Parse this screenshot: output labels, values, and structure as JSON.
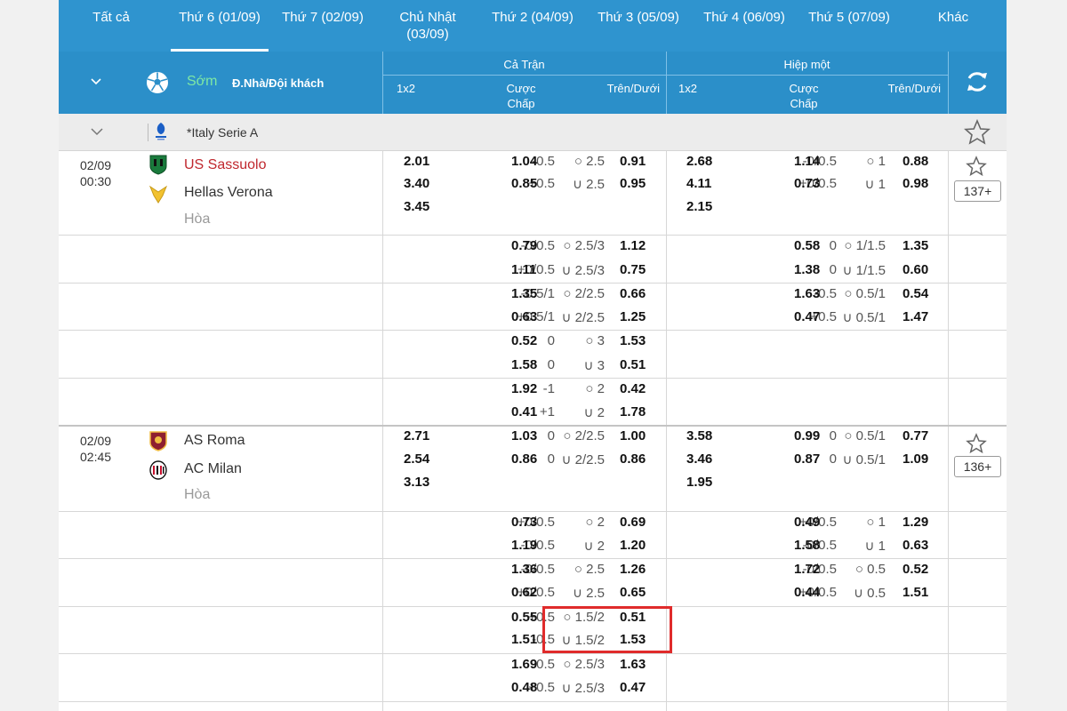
{
  "tabs": [
    {
      "label": "Tất cả"
    },
    {
      "label": "Thứ 6 (01/09)",
      "active": true
    },
    {
      "label": "Thứ 7 (02/09)"
    },
    {
      "label": "Chủ Nhật (03/09)"
    },
    {
      "label": "Thứ 2 (04/09)"
    },
    {
      "label": "Thứ 3 (05/09)"
    },
    {
      "label": "Thứ 4 (06/09)"
    },
    {
      "label": "Thứ 5 (07/09)"
    },
    {
      "label": "Khác"
    }
  ],
  "header": {
    "soon": "Sớm",
    "home_away": "Đ.Nhà/Đội khách",
    "full_match": "Cả Trận",
    "first_half": "Hiệp một",
    "col_1x2": "1x2",
    "col_handicap": "Cược Chấp",
    "col_ou": "Trên/Dưới"
  },
  "league": {
    "name": "*Italy Serie A"
  },
  "matches": [
    {
      "date": "02/09",
      "time": "00:30",
      "home": "US Sassuolo",
      "away": "Hellas Verona",
      "draw": "Hòa",
      "more": "137+",
      "x12": [
        "2.01",
        "3.40",
        "3.45"
      ],
      "x12_h1": [
        "2.68",
        "4.11",
        "2.15"
      ],
      "lines": [
        {
          "hc": [
            "-0.5",
            "1.04",
            "+0.5",
            "0.85"
          ],
          "ou": [
            "○ 2.5",
            "0.91",
            "∪ 2.5",
            "0.95"
          ],
          "hc1": [
            "-0/0.5",
            "1.14",
            "+0/0.5",
            "0.73"
          ],
          "ou1": [
            "○ 1",
            "0.88",
            "∪ 1",
            "0.98"
          ]
        },
        {
          "hc": [
            "-0/0.5",
            "0.79",
            "+0/0.5",
            "1.11"
          ],
          "ou": [
            "○ 2.5/3",
            "1.12",
            "∪ 2.5/3",
            "0.75"
          ],
          "hc1": [
            "0",
            "0.58",
            "0",
            "1.38"
          ],
          "ou1": [
            "○ 1/1.5",
            "1.35",
            "∪ 1/1.5",
            "0.60"
          ]
        },
        {
          "hc": [
            "-0.5/1",
            "1.35",
            "+0.5/1",
            "0.63"
          ],
          "ou": [
            "○ 2/2.5",
            "0.66",
            "∪ 2/2.5",
            "1.25"
          ],
          "hc1": [
            "-0.5",
            "1.63",
            "+0.5",
            "0.47"
          ],
          "ou1": [
            "○ 0.5/1",
            "0.54",
            "∪ 0.5/1",
            "1.47"
          ]
        },
        {
          "hc": [
            "0",
            "0.52",
            "0",
            "1.58"
          ],
          "ou": [
            "○ 3",
            "1.53",
            "∪ 3",
            "0.51"
          ]
        },
        {
          "hc": [
            "-1",
            "1.92",
            "+1",
            "0.41"
          ],
          "ou": [
            "○ 2",
            "0.42",
            "∪ 2",
            "1.78"
          ]
        }
      ]
    },
    {
      "date": "02/09",
      "time": "02:45",
      "home": "AS Roma",
      "away": "AC Milan",
      "draw": "Hòa",
      "more": "136+",
      "x12": [
        "2.71",
        "2.54",
        "3.13"
      ],
      "x12_h1": [
        "3.58",
        "3.46",
        "1.95"
      ],
      "lines": [
        {
          "hc": [
            "0",
            "1.03",
            "0",
            "0.86"
          ],
          "ou": [
            "○ 2/2.5",
            "1.00",
            "∪ 2/2.5",
            "0.86"
          ],
          "hc1": [
            "0",
            "0.99",
            "0",
            "0.87"
          ],
          "ou1": [
            "○ 0.5/1",
            "0.77",
            "∪ 0.5/1",
            "1.09"
          ]
        },
        {
          "hc": [
            "+0/0.5",
            "0.73",
            "-0/0.5",
            "1.19"
          ],
          "ou": [
            "○ 2",
            "0.69",
            "∪ 2",
            "1.20"
          ],
          "hc1": [
            "+0/0.5",
            "0.49",
            "-0/0.5",
            "1.58"
          ],
          "ou1": [
            "○ 1",
            "1.29",
            "∪ 1",
            "0.63"
          ]
        },
        {
          "hc": [
            "-0/0.5",
            "1.36",
            "+0/0.5",
            "0.62"
          ],
          "ou": [
            "○ 2.5",
            "1.26",
            "∪ 2.5",
            "0.65"
          ],
          "hc1": [
            "-0/0.5",
            "1.72",
            "+0/0.5",
            "0.44"
          ],
          "ou1": [
            "○ 0.5",
            "0.52",
            "∪ 0.5",
            "1.51"
          ]
        },
        {
          "hc": [
            "+0.5",
            "0.55",
            "-0.5",
            "1.51"
          ],
          "ou": [
            "○ 1.5/2",
            "0.51",
            "∪ 1.5/2",
            "1.53"
          ]
        },
        {
          "hc": [
            "-0.5",
            "1.69",
            "+0.5",
            "0.48"
          ],
          "ou": [
            "○ 2.5/3",
            "1.63",
            "∪ 2.5/3",
            "0.47"
          ]
        }
      ]
    }
  ],
  "colors": {
    "header_blue": "#2f94cf",
    "highlight_red": "#e02b2b",
    "favorite_team": "#c0282e",
    "soon_green": "#7ee8a4"
  }
}
